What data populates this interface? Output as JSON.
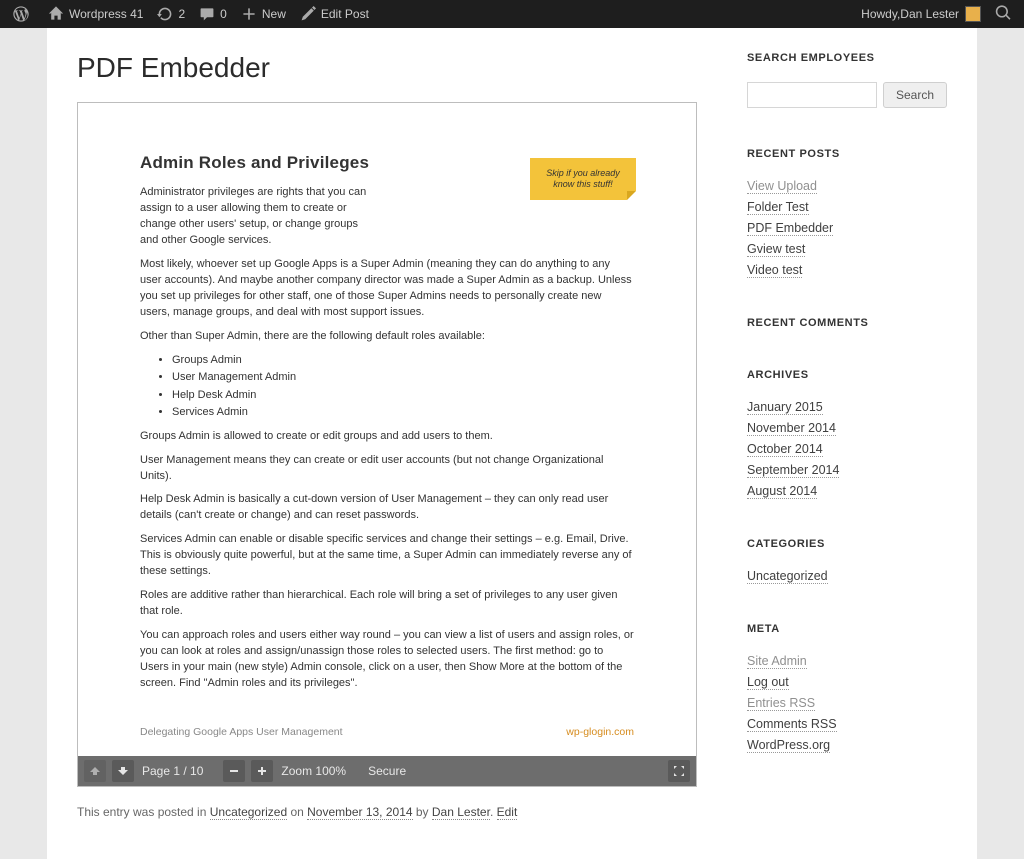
{
  "adminbar": {
    "site_name": "Wordpress 41",
    "updates": "2",
    "comments": "0",
    "new_label": "New",
    "edit_label": "Edit Post",
    "howdy_prefix": "Howdy, ",
    "user_name": "Dan Lester"
  },
  "post": {
    "title": "PDF Embedder",
    "meta_prefix": "This entry was posted in ",
    "category": "Uncategorized",
    "meta_on": " on ",
    "date": "November 13, 2014",
    "meta_by": " by ",
    "author": "Dan Lester",
    "edit": "Edit"
  },
  "pdf": {
    "heading": "Admin Roles and Privileges",
    "note": "Skip if you already know this stuff!",
    "p1": "Administrator privileges are rights that you can assign to a user allowing them to create or change other users' setup, or change groups and other Google services.",
    "p2": "Most likely, whoever set up Google Apps is a Super Admin (meaning they can do anything to any user accounts). And maybe another company director was made a Super Admin as a backup. Unless you set up privileges for other staff, one of those Super Admins needs to personally create new users, manage groups, and deal with most support issues.",
    "p3": "Other than Super Admin, there are the following default roles available:",
    "roles": [
      "Groups Admin",
      "User Management Admin",
      "Help Desk Admin",
      "Services Admin"
    ],
    "p4": "Groups Admin is allowed to create or edit groups and add users to them.",
    "p5": "User Management means they can create or edit user accounts (but not change Organizational Units).",
    "p6": "Help Desk Admin is basically a cut-down version of User Management – they can only read user details (can't create or change) and can reset passwords.",
    "p7": "Services Admin can enable or disable specific services and change their settings – e.g. Email, Drive. This is obviously quite powerful, but at the same time, a Super Admin can immediately reverse any of these settings.",
    "p8": "Roles are additive rather than hierarchical. Each role will bring a set of privileges to any user given that role.",
    "p9": "You can approach roles and users either way round – you can view a list of users and assign roles, or you can look at roles and assign/unassign those roles to selected users. The first method: go to Users in your main (new style) Admin console, click on a user, then Show More at the bottom of the screen. Find \"Admin roles and its privileges\".",
    "footer_left": "Delegating Google Apps User Management",
    "footer_right": "wp-glogin.com",
    "toolbar": {
      "page_label": "Page 1 / 10",
      "zoom_label": "Zoom 100%",
      "secure": "Secure"
    }
  },
  "sidebar": {
    "search": {
      "title": "SEARCH EMPLOYEES",
      "button": "Search"
    },
    "recent_posts": {
      "title": "RECENT POSTS",
      "items": [
        "View Upload",
        "Folder Test",
        "PDF Embedder",
        "Gview test",
        "Video test"
      ]
    },
    "recent_comments": {
      "title": "RECENT COMMENTS"
    },
    "archives": {
      "title": "ARCHIVES",
      "items": [
        "January 2015",
        "November 2014",
        "October 2014",
        "September 2014",
        "August 2014"
      ]
    },
    "categories": {
      "title": "CATEGORIES",
      "items": [
        "Uncategorized"
      ]
    },
    "meta": {
      "title": "META",
      "items": [
        "Site Admin",
        "Log out",
        "Entries RSS",
        "Comments RSS",
        "WordPress.org"
      ]
    }
  }
}
